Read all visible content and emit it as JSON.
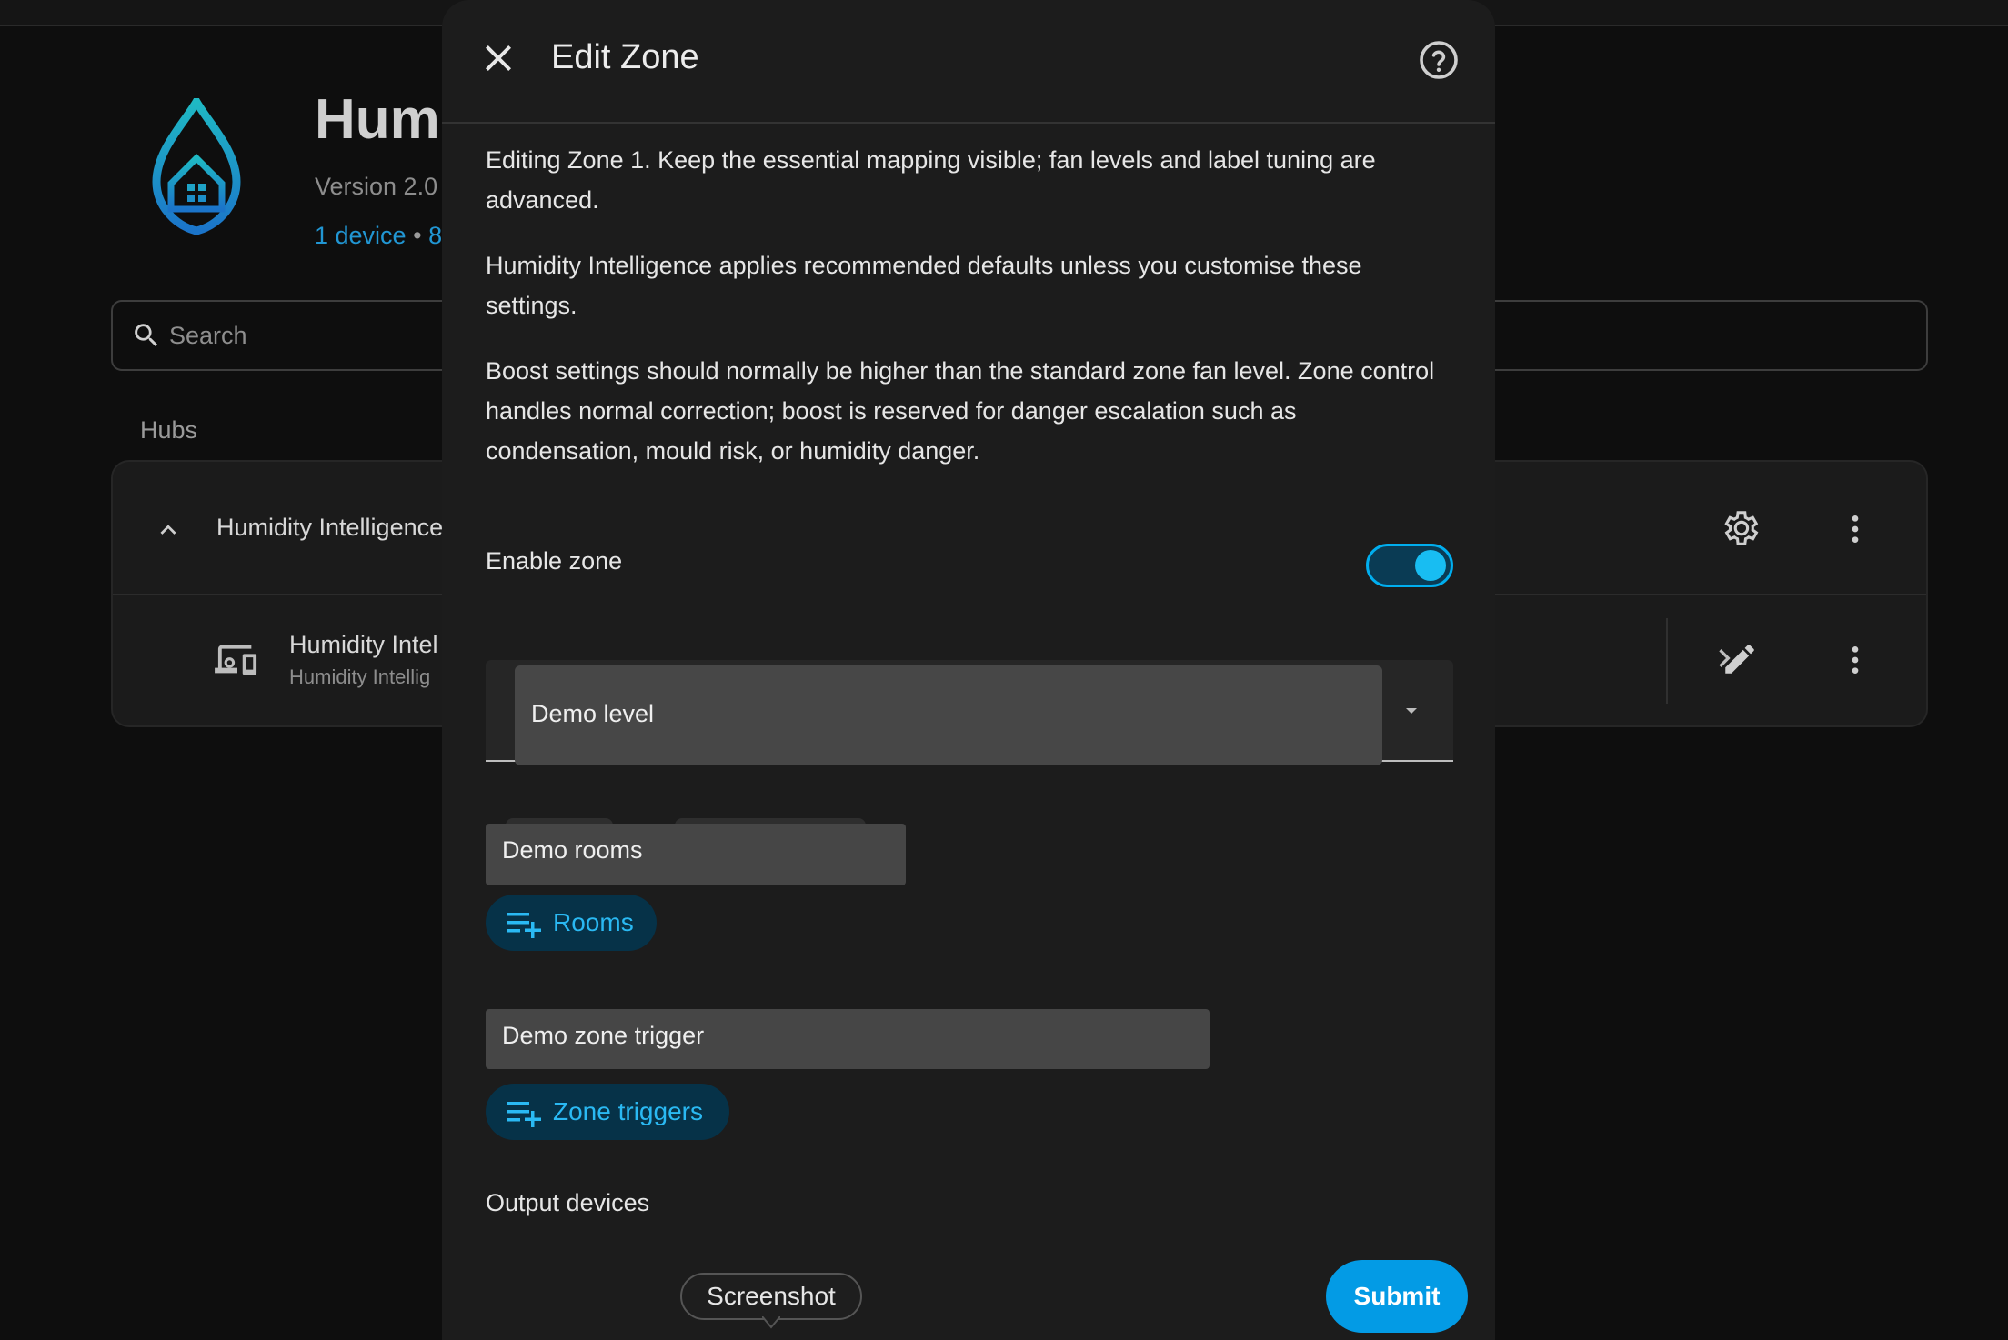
{
  "background": {
    "app_title": "Hum",
    "version": "Version 2.0",
    "links": {
      "device": "1 device",
      "separator": "•",
      "more": "8"
    },
    "search": {
      "placeholder": "Search"
    },
    "hubs_label": "Hubs",
    "hub": {
      "name": "Humidity Intelligence"
    },
    "device": {
      "name": "Humidity Intel",
      "subtitle": "Humidity Intellig"
    }
  },
  "dialog": {
    "title": "Edit Zone",
    "paragraphs": [
      "Editing Zone 1. Keep the essential mapping visible; fan levels and label tuning are advanced.",
      "Humidity Intelligence applies recommended defaults unless you customise these settings.",
      "Boost settings should normally be higher than the standard zone fan level. Zone control handles normal correction; boost is reserved for danger escalation such as condensation, mould risk, or humidity danger."
    ],
    "enable_zone": {
      "label": "Enable zone",
      "checked": true
    },
    "level_select": {
      "value": "Demo level"
    },
    "rooms": {
      "selected": "Demo rooms",
      "button_label": "Rooms"
    },
    "zone_triggers": {
      "selected": "Demo zone trigger",
      "button_label": "Zone triggers"
    },
    "output_devices_label": "Output devices",
    "submit_label": "Submit"
  },
  "tooltip": {
    "text": "Screenshot"
  },
  "colors": {
    "accent": "#039be5",
    "toggle_on": "#18bdf2",
    "link": "#2196d3",
    "dialog_bg": "#1c1c1c",
    "page_bg": "#0e0e0e"
  }
}
